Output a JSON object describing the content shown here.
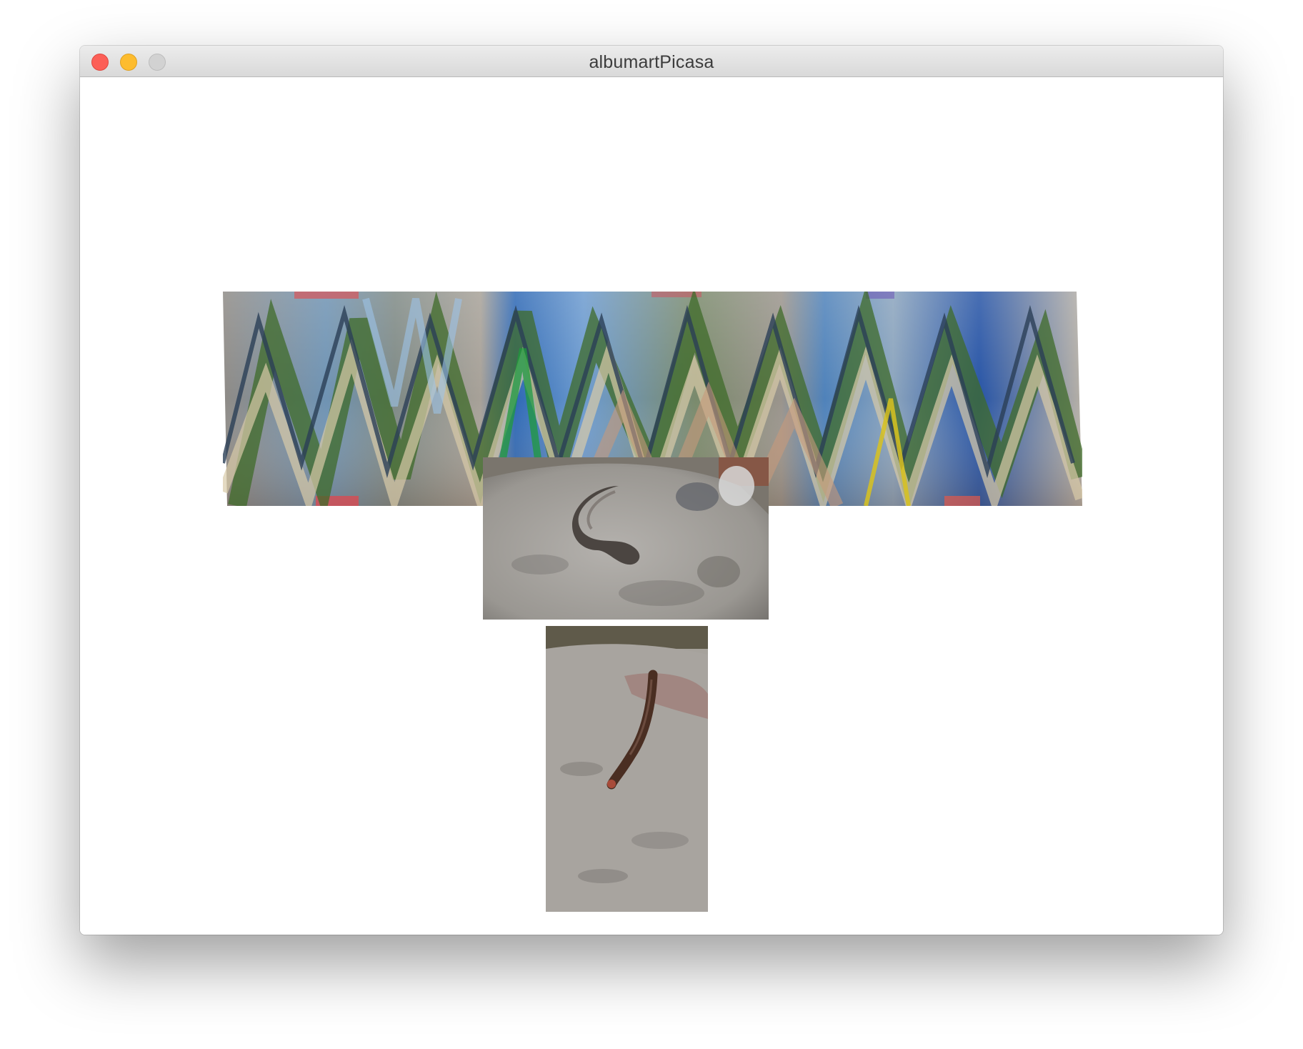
{
  "window": {
    "title": "albumartPicasa"
  },
  "controls": {
    "close_icon": "close-icon",
    "minimize_icon": "minimize-icon",
    "zoom_icon": "zoom-icon"
  },
  "canvas": {
    "images": [
      {
        "name": "warped-wave-collage"
      },
      {
        "name": "slug-on-rock-photo"
      },
      {
        "name": "millipede-on-rock-photo"
      }
    ]
  },
  "colors": {
    "close": "#fc5f57",
    "minimize": "#fdbc2e",
    "zoom": "#d2d2d2",
    "titlebar": "#e2e2e2"
  }
}
